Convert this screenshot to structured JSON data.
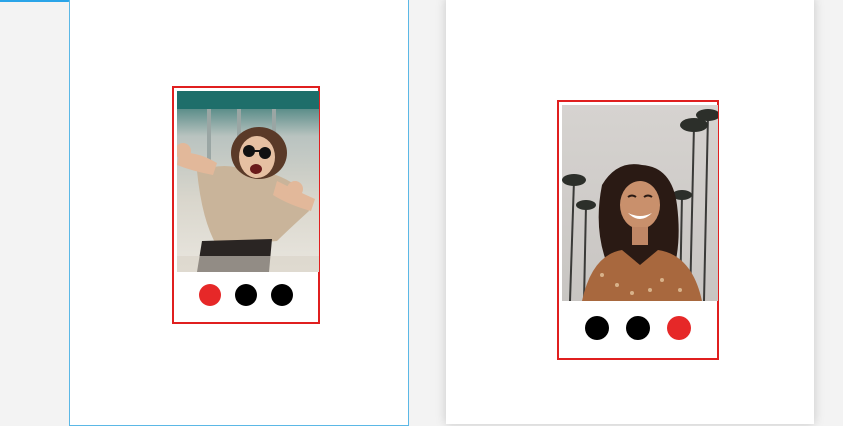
{
  "colors": {
    "accent_red": "#e62828",
    "card_border": "#e01f1f",
    "frame_border": "#5bb8e6",
    "inactive_dot": "#000000"
  },
  "left_card": {
    "image_icon": "photo-woman-sunglasses-peace-sign",
    "dots": [
      {
        "state": "active"
      },
      {
        "state": "inactive"
      },
      {
        "state": "inactive"
      }
    ],
    "active_index": 0
  },
  "right_card": {
    "image_icon": "photo-woman-smiling-palm-trees",
    "dots": [
      {
        "state": "inactive"
      },
      {
        "state": "inactive"
      },
      {
        "state": "active"
      }
    ],
    "active_index": 2
  }
}
